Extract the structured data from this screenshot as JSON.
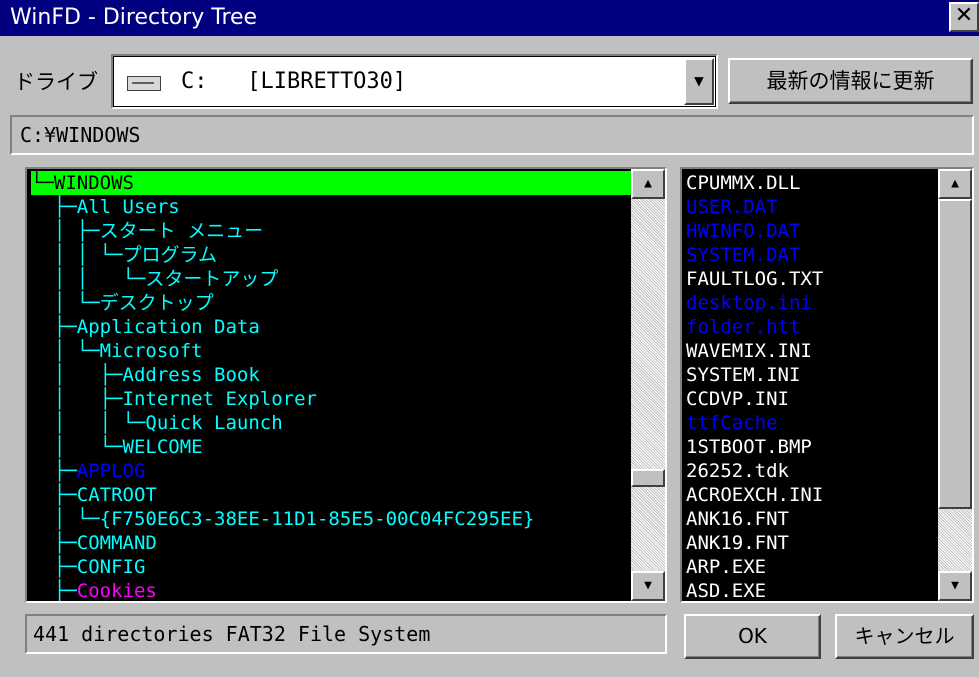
{
  "window": {
    "title": "WinFD - Directory Tree",
    "close_glyph": "✕"
  },
  "drive": {
    "label": "ドライブ",
    "value": "C:   [LIBRETTO30]",
    "dropdown_glyph": "▼"
  },
  "refresh_button": "最新の情報に更新",
  "path": "C:¥WINDOWS",
  "tree": {
    "colors": {
      "normal": "#00ffff",
      "system": "#0000ff",
      "hidden": "#ff00ff",
      "selected_bg": "#00ff00"
    },
    "rows": [
      {
        "lines": "└─",
        "name": "WINDOWS",
        "kind": "selected"
      },
      {
        "lines": "  ├─",
        "name": "All Users",
        "kind": "normal"
      },
      {
        "lines": "  │ ├─",
        "name": "スタート メニュー",
        "kind": "normal"
      },
      {
        "lines": "  │ │ └─",
        "name": "プログラム",
        "kind": "normal"
      },
      {
        "lines": "  │ │   └─",
        "name": "スタートアップ",
        "kind": "normal"
      },
      {
        "lines": "  │ └─",
        "name": "デスクトップ",
        "kind": "normal"
      },
      {
        "lines": "  ├─",
        "name": "Application Data",
        "kind": "normal"
      },
      {
        "lines": "  │ └─",
        "name": "Microsoft",
        "kind": "normal"
      },
      {
        "lines": "  │   ├─",
        "name": "Address Book",
        "kind": "normal"
      },
      {
        "lines": "  │   ├─",
        "name": "Internet Explorer",
        "kind": "normal"
      },
      {
        "lines": "  │   │ └─",
        "name": "Quick Launch",
        "kind": "normal"
      },
      {
        "lines": "  │   └─",
        "name": "WELCOME",
        "kind": "normal"
      },
      {
        "lines": "  ├─",
        "name": "APPLOG",
        "kind": "system"
      },
      {
        "lines": "  ├─",
        "name": "CATROOT",
        "kind": "normal"
      },
      {
        "lines": "  │ └─",
        "name": "{F750E6C3-38EE-11D1-85E5-00C04FC295EE}",
        "kind": "normal"
      },
      {
        "lines": "  ├─",
        "name": "COMMAND",
        "kind": "normal"
      },
      {
        "lines": "  ├─",
        "name": "CONFIG",
        "kind": "normal"
      },
      {
        "lines": "  ├─",
        "name": "Cookies",
        "kind": "hidden"
      }
    ]
  },
  "files": {
    "colors": {
      "normal": "#ffffff",
      "system": "#0000ff"
    },
    "rows": [
      {
        "name": "CPUMMX.DLL",
        "kind": "normal"
      },
      {
        "name": "USER.DAT",
        "kind": "system"
      },
      {
        "name": "HWINFO.DAT",
        "kind": "system"
      },
      {
        "name": "SYSTEM.DAT",
        "kind": "system"
      },
      {
        "name": "FAULTLOG.TXT",
        "kind": "normal"
      },
      {
        "name": "desktop.ini",
        "kind": "system"
      },
      {
        "name": "folder.htt",
        "kind": "system"
      },
      {
        "name": "WAVEMIX.INI",
        "kind": "normal"
      },
      {
        "name": "SYSTEM.INI",
        "kind": "normal"
      },
      {
        "name": "CCDVP.INI",
        "kind": "normal"
      },
      {
        "name": "ttfCache",
        "kind": "system"
      },
      {
        "name": "1STBOOT.BMP",
        "kind": "normal"
      },
      {
        "name": "26252.tdk",
        "kind": "normal"
      },
      {
        "name": "ACROEXCH.INI",
        "kind": "normal"
      },
      {
        "name": "ANK16.FNT",
        "kind": "normal"
      },
      {
        "name": "ANK19.FNT",
        "kind": "normal"
      },
      {
        "name": "ARP.EXE",
        "kind": "normal"
      },
      {
        "name": "ASD.EXE",
        "kind": "normal"
      }
    ]
  },
  "scrollbar": {
    "up_glyph": "▲",
    "down_glyph": "▼"
  },
  "status": "441 directories  FAT32 File System",
  "ok_button": "OK",
  "cancel_button": "キャンセル"
}
